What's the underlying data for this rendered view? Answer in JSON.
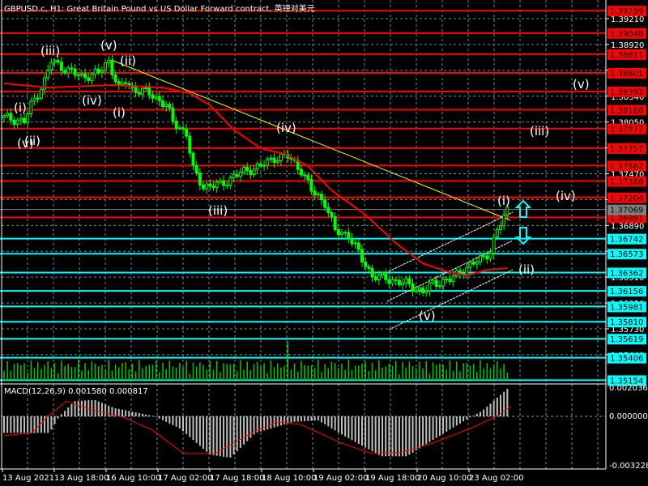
{
  "window": {
    "title": "GBPUSD.c, H1:  Great Britain Pound vs US Dollar Forward contract, 英镑对美元"
  },
  "colors": {
    "bull": "#00ff00",
    "bear": "#00ff00",
    "ma": "#ff0000",
    "resistance": "#ff0000",
    "support": "#00ffff",
    "trend": "#ffff00",
    "channel": "#ffffff",
    "current": "#808080"
  },
  "chart_data": [
    {
      "type": "candlestick",
      "symbol": "GBPUSD.c",
      "timeframe": "H1",
      "ylim": [
        1.35,
        1.3935
      ],
      "price_axis_labels": [
        "1.39210",
        "1.38920",
        "1.38630",
        "1.38340",
        "1.38050",
        "1.37760",
        "1.37470",
        "1.37180",
        "1.36890",
        "1.36600",
        "1.36310",
        "1.36020",
        "1.35730",
        "1.35440"
      ],
      "x_tick_labels": [
        "13 Aug 2021",
        "13 Aug 18:00",
        "16 Aug 10:00",
        "17 Aug 02:00",
        "17 Aug 18:00",
        "18 Aug 10:00",
        "19 Aug 02:00",
        "19 Aug 18:00",
        "20 Aug 10:00",
        "23 Aug 02:00"
      ],
      "bars": 150,
      "close_keypoints": [
        [
          0,
          1.38101
        ],
        [
          6,
          1.38056
        ],
        [
          8,
          1.38238
        ],
        [
          12,
          1.3851
        ],
        [
          14,
          1.38737
        ],
        [
          18,
          1.38647
        ],
        [
          23,
          1.38556
        ],
        [
          28,
          1.38601
        ],
        [
          31,
          1.38737
        ],
        [
          34,
          1.38419
        ],
        [
          36,
          1.3851
        ],
        [
          38,
          1.38419
        ],
        [
          43,
          1.38374
        ],
        [
          48,
          1.38238
        ],
        [
          50,
          1.38056
        ],
        [
          54,
          1.37919
        ],
        [
          56,
          1.3751
        ],
        [
          59,
          1.37329
        ],
        [
          64,
          1.37346
        ],
        [
          70,
          1.37483
        ],
        [
          76,
          1.37556
        ],
        [
          80,
          1.37647
        ],
        [
          84,
          1.37665
        ],
        [
          88,
          1.3751
        ],
        [
          91,
          1.37283
        ],
        [
          95,
          1.37147
        ],
        [
          98,
          1.36828
        ],
        [
          102,
          1.36783
        ],
        [
          106,
          1.3651
        ],
        [
          109,
          1.36328
        ],
        [
          114,
          1.36283
        ],
        [
          119,
          1.36237
        ],
        [
          124,
          1.36147
        ],
        [
          127,
          1.36237
        ],
        [
          132,
          1.36283
        ],
        [
          137,
          1.36419
        ],
        [
          141,
          1.3651
        ],
        [
          144,
          1.36601
        ],
        [
          146,
          1.36828
        ],
        [
          149,
          1.37069
        ]
      ],
      "ma_keypoints": [
        [
          0,
          1.38483
        ],
        [
          13,
          1.38437
        ],
        [
          32,
          1.38465
        ],
        [
          47,
          1.38437
        ],
        [
          55,
          1.38374
        ],
        [
          61,
          1.38238
        ],
        [
          68,
          1.37965
        ],
        [
          76,
          1.37756
        ],
        [
          83,
          1.37692
        ],
        [
          90,
          1.37556
        ],
        [
          97,
          1.37283
        ],
        [
          107,
          1.3701
        ],
        [
          116,
          1.36692
        ],
        [
          124,
          1.36465
        ],
        [
          131,
          1.36374
        ],
        [
          137,
          1.36328
        ],
        [
          143,
          1.36392
        ],
        [
          149,
          1.3641
        ]
      ],
      "current_price": "1.37069",
      "resistance_levels": [
        "1.39299",
        "1.39048",
        "1.38811",
        "1.38601",
        "1.38392",
        "1.38188",
        "1.37977",
        "1.37757",
        "1.37562",
        "1.37388",
        "1.37204",
        "1.36981"
      ],
      "support_levels": [
        "1.36742",
        "1.36573",
        "1.36362",
        "1.36156",
        "1.35981",
        "1.35810",
        "1.35619",
        "1.35406",
        "1.35154"
      ],
      "wave_labels": [
        "(i)",
        "(v)",
        "(ii)",
        "(iii)",
        "(v)",
        "(ii)",
        "(iv)",
        "(i)",
        "(iii)",
        "(iv)",
        "(i)",
        "(v)",
        "(ii)",
        "(iv)",
        "(iii)",
        "(v)"
      ]
    },
    {
      "type": "bar",
      "title": "MACD(12,26,9) 0.001580 0.000817",
      "ylim": [
        -0.003228,
        0.002036
      ],
      "y_tick_labels": [
        "0.002036",
        "0.000000",
        "-0.003228"
      ],
      "histogram_keypoints": [
        [
          0,
          -0.0012
        ],
        [
          18,
          -0.0012
        ],
        [
          22,
          0.0
        ],
        [
          28,
          0.0011
        ],
        [
          36,
          0.0012
        ],
        [
          44,
          0.0006
        ],
        [
          52,
          0.0003
        ],
        [
          60,
          0.0
        ],
        [
          70,
          -0.0009
        ],
        [
          82,
          -0.0028
        ],
        [
          90,
          -0.003
        ],
        [
          100,
          -0.0012
        ],
        [
          115,
          -0.0004
        ],
        [
          125,
          -0.0003
        ],
        [
          135,
          -0.0014
        ],
        [
          150,
          -0.0029
        ],
        [
          160,
          -0.0029
        ],
        [
          175,
          -0.0012
        ],
        [
          185,
          -0.0001
        ],
        [
          190,
          0.0004
        ],
        [
          200,
          0.002
        ]
      ],
      "signal_keypoints": [
        [
          0,
          -0.0014
        ],
        [
          18,
          -0.0012
        ],
        [
          28,
          0.0
        ],
        [
          40,
          0.0011
        ],
        [
          55,
          0.0005
        ],
        [
          75,
          0.0
        ],
        [
          95,
          -0.001
        ],
        [
          115,
          -0.0027
        ],
        [
          135,
          -0.0027
        ],
        [
          160,
          -0.0011
        ],
        [
          175,
          -0.0004
        ],
        [
          190,
          -0.0006
        ],
        [
          215,
          -0.0019
        ],
        [
          235,
          -0.0027
        ],
        [
          255,
          -0.0026
        ],
        [
          275,
          -0.0019
        ],
        [
          300,
          -0.0008
        ],
        [
          315,
          0.0
        ],
        [
          325,
          0.0008
        ]
      ],
      "histogram_bars": 150
    }
  ]
}
